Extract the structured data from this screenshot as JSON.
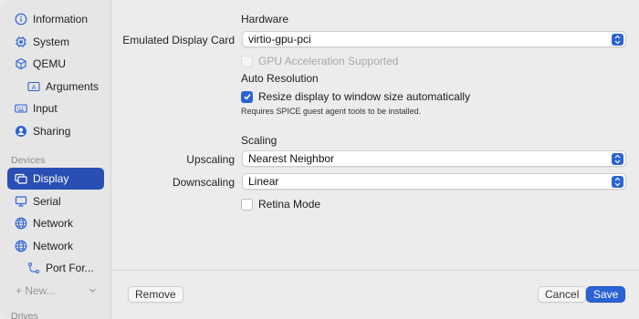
{
  "sidebar": {
    "items": [
      {
        "label": "Information",
        "icon": "info-icon"
      },
      {
        "label": "System",
        "icon": "chip-icon"
      },
      {
        "label": "QEMU",
        "icon": "cube-icon"
      },
      {
        "label": "Arguments",
        "icon": "text-field-icon"
      },
      {
        "label": "Input",
        "icon": "keyboard-icon"
      },
      {
        "label": "Sharing",
        "icon": "person-circle-icon"
      },
      {
        "label": "Display",
        "icon": "display-icon"
      },
      {
        "label": "Serial",
        "icon": "monitor-icon"
      },
      {
        "label": "Network",
        "icon": "globe-icon"
      },
      {
        "label": "Network",
        "icon": "globe-icon"
      },
      {
        "label": "Port For...",
        "icon": "port-forward-icon"
      }
    ],
    "section_devices": "Devices",
    "new_label": "+ New...",
    "section_drives": "Drives"
  },
  "hardware": {
    "title": "Hardware",
    "card_label": "Emulated Display Card",
    "card_value": "virtio-gpu-pci",
    "gpu_accel_label": "GPU Acceleration Supported"
  },
  "auto_resolution": {
    "title": "Auto Resolution",
    "resize_label": "Resize display to window size automatically",
    "resize_checked": true,
    "note": "Requires SPICE guest agent tools to be installed."
  },
  "scaling": {
    "title": "Scaling",
    "upscaling_label": "Upscaling",
    "upscaling_value": "Nearest Neighbor",
    "downscaling_label": "Downscaling",
    "downscaling_value": "Linear",
    "retina_label": "Retina Mode",
    "retina_checked": false
  },
  "footer": {
    "remove": "Remove",
    "cancel": "Cancel",
    "save": "Save"
  },
  "colors": {
    "accent": "#2a63d6",
    "selected": "#2a4fb4"
  }
}
